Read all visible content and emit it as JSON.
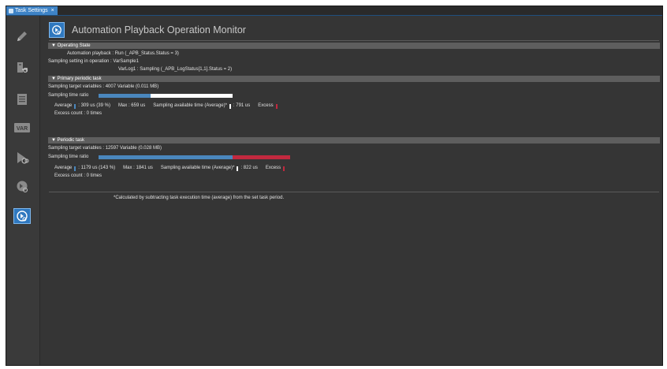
{
  "tab": {
    "label": "Task Settings",
    "close": "×"
  },
  "sidebar": {
    "var_label": "VAR"
  },
  "header": {
    "title": "Automation Playback Operation Monitor"
  },
  "operating_state": {
    "title": "Operating State",
    "playback": "Automation playback : Run (_APB_Status.Status = 3)",
    "sampling_setting": "Sampling setting in operation : VarSample1",
    "varlog": "VarLog1 : Sampling (_APB_LogStatus[1,1].Status = 2)"
  },
  "primary": {
    "title": "Primary periodic task",
    "targets": "Sampling target variables : 4007 Variable  (0.011 MB)",
    "ratio_label": "Sampling time ratio",
    "ratio_avg_fraction": 0.39,
    "ratio_excess_fraction": 0,
    "avg_label": "Average",
    "avg_value": ": 309 us (39 %)",
    "max": "Max : 659 us",
    "avail_label": "Sampling available time (Average)*",
    "avail_value": ": 791 us",
    "excess_label": "Excess",
    "excess_count": "Excess count : 0 times"
  },
  "periodic": {
    "title": "Periodic task",
    "targets": "Sampling target variables : 12597 Variable  (0.028 MB)",
    "ratio_label": "Sampling time ratio",
    "ratio_avg_fraction": 0.7,
    "ratio_excess_fraction": 0.3,
    "avg_label": "Average",
    "avg_value": ": 1179 us (143 %)",
    "max": "Max : 1841 us",
    "avail_label": "Sampling available time (Average)*",
    "avail_value": ": 822 us",
    "excess_label": "Excess",
    "excess_count": "Excess count : 0 times"
  },
  "footnote": "*Calculated by subtracting task execution time (average) from the set task period.",
  "colors": {
    "average": "#4a87bd",
    "available": "#ffffff",
    "excess": "#c2293f",
    "accent": "#2f78bf"
  },
  "icons": [
    "pencil-icon",
    "export-icon",
    "list-icon",
    "var-icon",
    "playback-icon",
    "monitor-icon",
    "operation-monitor-icon"
  ]
}
